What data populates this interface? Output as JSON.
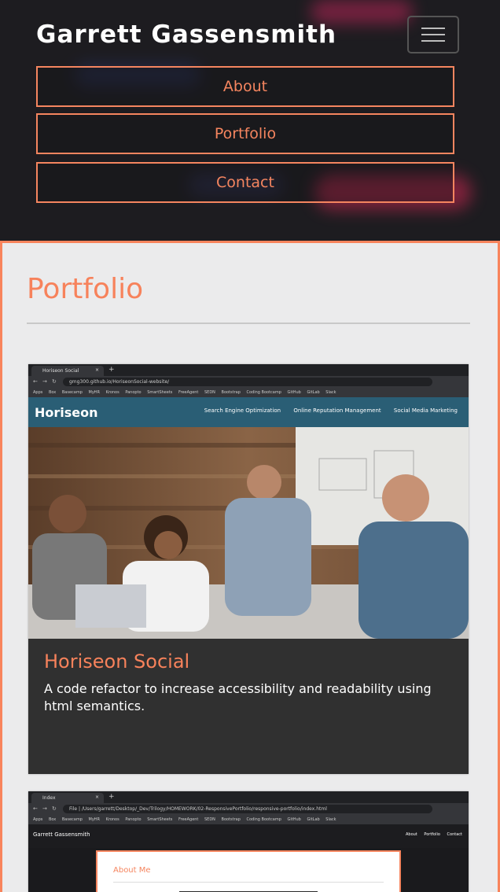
{
  "header": {
    "brand": "Garrett Gassensmith",
    "toggle_icon": "hamburger-menu-icon",
    "nav": [
      "About",
      "Portfolio",
      "Contact"
    ]
  },
  "colors": {
    "accent": "#f7825b",
    "header_bg": "#1d1c20",
    "section_bg": "#ebebec",
    "card_bg": "#303030",
    "horiseon_teal": "#2a5e75"
  },
  "portfolio": {
    "heading": "Portfolio",
    "cards": [
      {
        "title": "Horiseon Social",
        "description": "A code refactor to increase accessibility and readability using html semantics.",
        "screenshot": {
          "tab": "Horiseon Social",
          "url": "gmg300.github.io/HoriseonSocial-website/",
          "bookmarks": [
            "Apps",
            "Box",
            "Basecamp",
            "MyHR",
            "Kronos",
            "Panopto",
            "SmartSheets",
            "FreeAgent",
            "SEDN",
            "Bootstrap",
            "Coding Bootcamp",
            "GitHub",
            "GitLab",
            "Slack"
          ],
          "logo": "Horiseon",
          "links": [
            "Search Engine Optimization",
            "Online Reputation Management",
            "Social Media Marketing"
          ]
        }
      },
      {
        "title": "",
        "description": "",
        "screenshot": {
          "tab": "Index",
          "url": "File | /Users/garrett/Desktop/_Dev/Trilogy/HOMEWORK/02-ResponsivePortfolio/responsive-portfolio/index.html",
          "bookmarks": [
            "Apps",
            "Box",
            "Basecamp",
            "MyHR",
            "Kronos",
            "Panopto",
            "SmartSheets",
            "FreeAgent",
            "SEDN",
            "Bootstrap",
            "Coding Bootcamp",
            "GitHub",
            "GitLab",
            "Slack"
          ],
          "brand": "Garrett Gassensmith",
          "links": [
            "About",
            "Portfolio",
            "Contact"
          ],
          "panel_heading": "About Me"
        }
      }
    ]
  }
}
